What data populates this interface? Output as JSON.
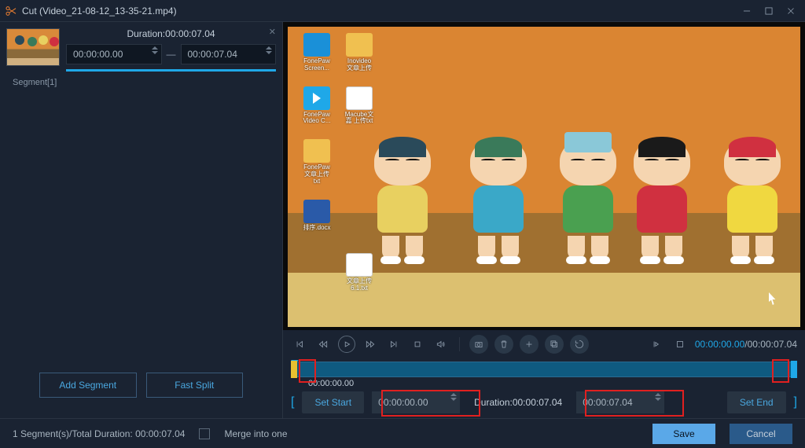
{
  "window": {
    "title": "Cut (Video_21-08-12_13-35-21.mp4)"
  },
  "segment": {
    "duration_label": "Duration:00:00:07.04",
    "start_time": "00:00:00.00",
    "end_time": "00:00:07.04",
    "name": "Segment[1]"
  },
  "left_buttons": {
    "add": "Add Segment",
    "split": "Fast Split"
  },
  "desktop_icons": [
    {
      "label": "FonePaw Screen..."
    },
    {
      "label": "FonePaw Video C..."
    },
    {
      "label": ""
    },
    {
      "label": "FonePaw文章上传txt"
    },
    {
      "label": "排序.docx"
    },
    {
      "label": "Inovideo文章上传"
    },
    {
      "label": "Macube文嘉 上传txt"
    },
    {
      "label": "文章上传 6.1.txt"
    }
  ],
  "playback": {
    "current": "00:00:00.00",
    "total": "00:00:07.04"
  },
  "timeline": {
    "position_label": "00:00:00.00"
  },
  "setbar": {
    "set_start": "Set Start",
    "start_val": "00:00:00.00",
    "duration_label": "Duration:00:00:07.04",
    "end_val": "00:00:07.04",
    "set_end": "Set End"
  },
  "footer": {
    "summary": "1 Segment(s)/Total Duration: 00:00:07.04",
    "merge": "Merge into one",
    "save": "Save",
    "cancel": "Cancel"
  }
}
